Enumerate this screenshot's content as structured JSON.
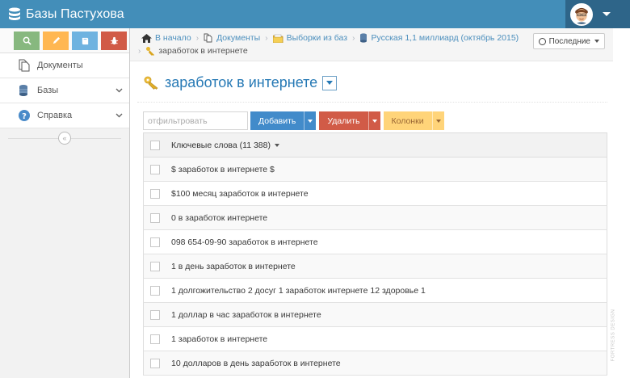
{
  "app": {
    "title": "Базы Пастухова"
  },
  "sidebar": {
    "items": [
      {
        "label": "Документы",
        "icon": "documents-icon"
      },
      {
        "label": "Базы",
        "icon": "databases-icon"
      },
      {
        "label": "Справка",
        "icon": "help-icon"
      }
    ],
    "shortcuts": [
      {
        "icon": "search-icon",
        "color": "#87b87f"
      },
      {
        "icon": "pencil-icon",
        "color": "#ffb752"
      },
      {
        "icon": "book-icon",
        "color": "#6fb3e0"
      },
      {
        "icon": "bug-icon",
        "color": "#d15b47"
      }
    ]
  },
  "breadcrumbs": {
    "items": [
      {
        "label": "В начало",
        "icon": "home-icon"
      },
      {
        "label": "Документы",
        "icon": "documents-icon"
      },
      {
        "label": "Выборки из баз",
        "icon": "folder-icon"
      },
      {
        "label": "Русская 1,1 миллиард (октябрь 2015)",
        "icon": "database-icon"
      },
      {
        "label": "заработок в интернете",
        "icon": "keys-icon"
      }
    ],
    "recent_label": "Последние"
  },
  "page": {
    "title": "заработок в интернете"
  },
  "toolbar": {
    "filter_placeholder": "отфильтровать",
    "add_label": "Добавить",
    "delete_label": "Удалить",
    "columns_label": "Колонки"
  },
  "table": {
    "header": "Ключевые слова (11 388)",
    "rows": [
      "$ заработок в интернете $",
      "$100 месяц заработок в интернете",
      "0 в заработок интернете",
      "098 654-09-90 заработок в интернете",
      "1 в день заработок в интернете",
      "1 долгожительство 2 досуг 1 заработок интернете 12 здоровье 1",
      "1 доллар в час заработок в интернете",
      "1 заработок в интернете",
      "10 долларов в день заработок в интернете"
    ]
  },
  "watermark": "FORTRESS DESIGN",
  "colors": {
    "navbar": "#438eb9",
    "accent": "#2679b5",
    "add": "#428bca",
    "delete": "#d15b47",
    "columns": "#ffd479"
  }
}
